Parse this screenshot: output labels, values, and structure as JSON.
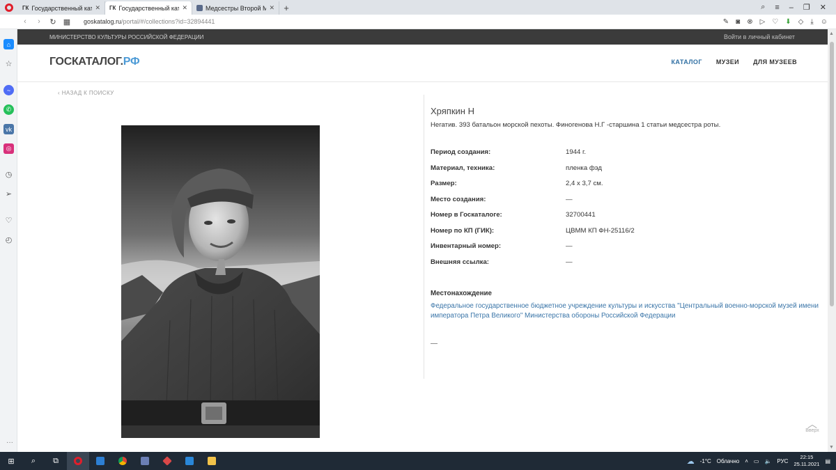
{
  "browser": {
    "tabs": [
      {
        "favicon": "ГК",
        "label": "Государственный каталог",
        "active": false
      },
      {
        "favicon": "ГК",
        "label": "Государственный каталог",
        "active": true
      },
      {
        "favicon": "",
        "label": "Медсестры Второй Миро",
        "active": false
      }
    ],
    "url_domain": "goskatalog.ru",
    "url_path": "/portal/#/collections?id=32894441"
  },
  "topbar": {
    "ministry": "МИНИСТЕРСТВО КУЛЬТУРЫ РОССИЙСКОЙ ФЕДЕРАЦИИ",
    "login": "Войти в личный кабинет"
  },
  "header": {
    "logo_main": "ГОСКАТАЛОГ.",
    "logo_accent": "РФ",
    "nav": [
      "КАТАЛОГ",
      "МУЗЕИ",
      "ДЛЯ МУЗЕЕВ"
    ]
  },
  "back_link": "НАЗАД К ПОИСКУ",
  "item": {
    "title": "Хряпкин Н",
    "description": "Негатив. 393 батальон морской пехоты. Финогенова Н.Г -старшина 1 статьи медсестра роты.",
    "properties": [
      {
        "key": "Период создания:",
        "value": "1944 г."
      },
      {
        "key": "Материал, техника:",
        "value": "пленка фэд"
      },
      {
        "key": "Размер:",
        "value": "2,4 х 3,7 см."
      },
      {
        "key": "Место создания:",
        "value": "—"
      },
      {
        "key": "Номер в Госкаталоге:",
        "value": "32700441"
      },
      {
        "key": "Номер по КП (ГИК):",
        "value": "ЦВММ КП ФН-25116/2"
      },
      {
        "key": "Инвентарный номер:",
        "value": "—"
      },
      {
        "key": "Внешняя ссылка:",
        "value": "—"
      }
    ],
    "location_heading": "Местонахождение",
    "location": "Федеральное государственное бюджетное учреждение культуры и искусства \"Центральный военно-морской музей имени императора Петра Великого\" Министерства обороны Российской Федерации",
    "extra": "—"
  },
  "scroll_up_label": "Вверх",
  "taskbar": {
    "weather_temp": "-1°C",
    "weather_text": "Облачно",
    "lang": "РУС",
    "time": "22:15",
    "date": "25.11.2021"
  },
  "colors": {
    "accent_blue": "#2f6fa3",
    "link_blue": "#3a75a8",
    "topbar_dark": "#3b3b3b",
    "logo_accent": "#4c9ad6"
  }
}
